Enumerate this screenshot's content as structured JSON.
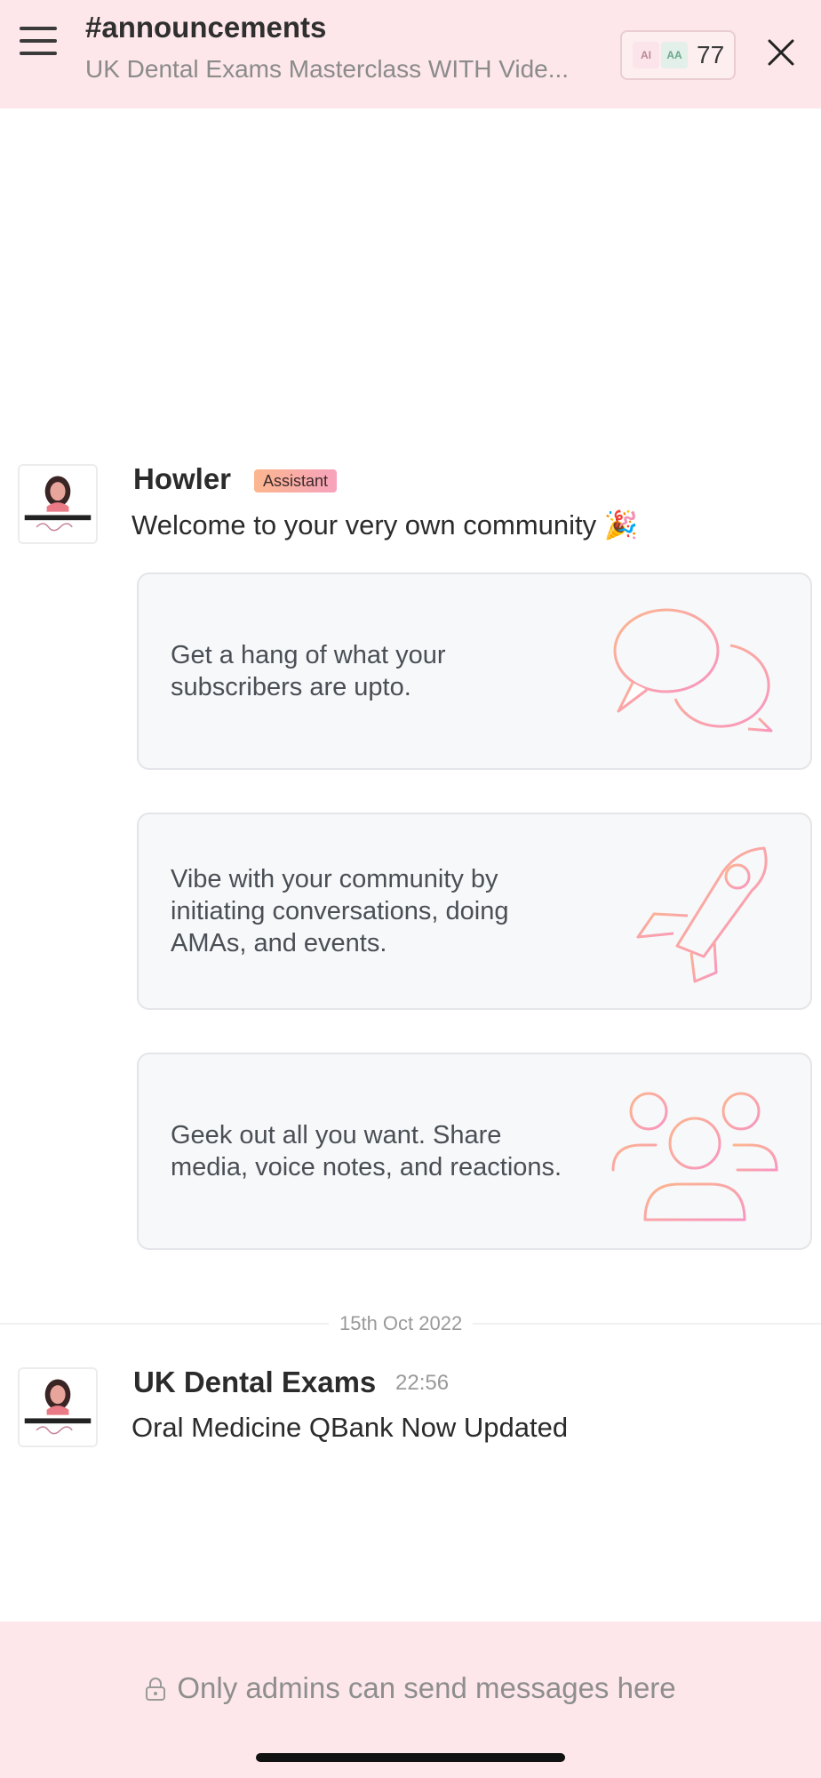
{
  "header": {
    "channel_title": "#announcements",
    "channel_subtitle": "UK Dental Exams Masterclass WITH Vide...",
    "members": {
      "avatar1": "AI",
      "avatar2": "AA",
      "count": "77"
    }
  },
  "messages": [
    {
      "sender": "Howler",
      "badge": "Assistant",
      "text": "Welcome to your very own community 🎉",
      "cards": [
        {
          "text": "Get a hang of what your subscribers are upto.",
          "icon": "chat-bubbles-icon"
        },
        {
          "text": "Vibe with your community by initiating conversations, doing AMAs, and events.",
          "icon": "rocket-icon"
        },
        {
          "text": "Geek out all you want. Share media, voice notes, and reactions.",
          "icon": "people-group-icon"
        }
      ]
    },
    {
      "date_separator": "15th Oct 2022",
      "sender": "UK Dental Exams",
      "time": "22:56",
      "text": "Oral Medicine QBank Now Updated"
    }
  ],
  "footer": {
    "note": "Only admins can send messages here",
    "icon": "lock-icon"
  },
  "colors": {
    "header_bg": "#fde7ea",
    "accent_orange": "#fcb68e",
    "accent_pink": "#f7a3bd",
    "card_bg": "#f7f8fa"
  }
}
